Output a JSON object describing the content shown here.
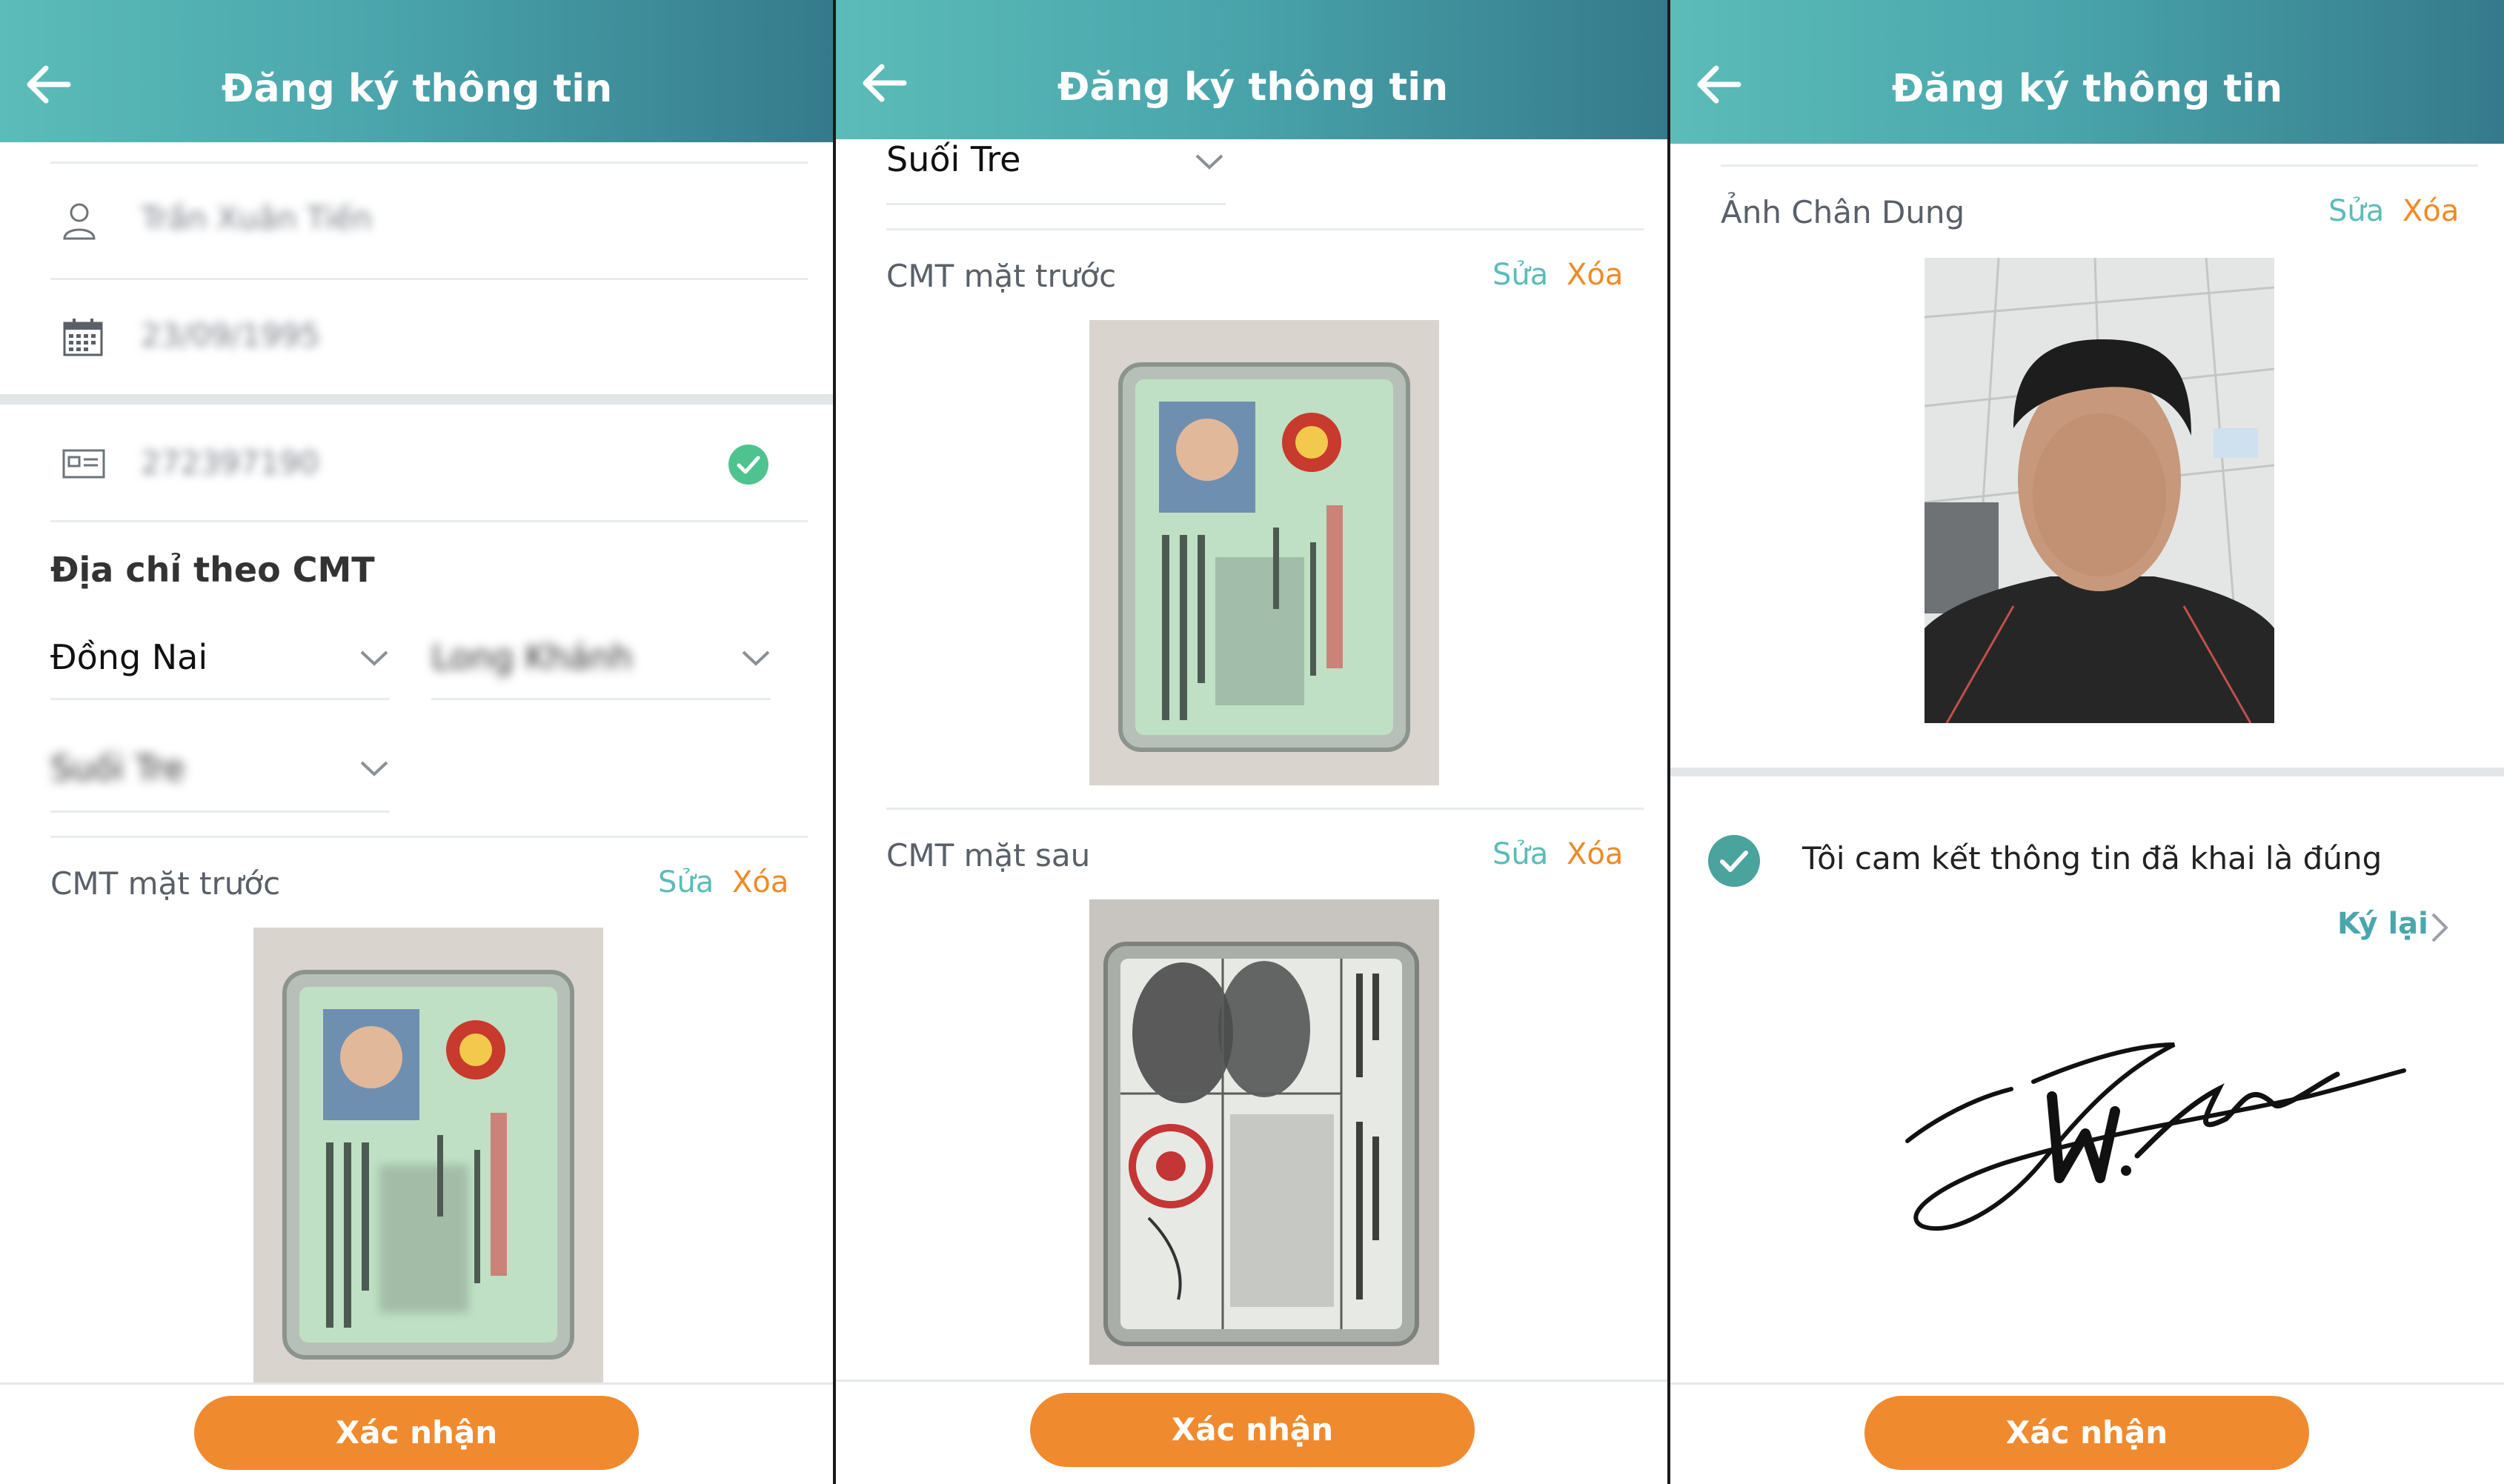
{
  "header": {
    "title": "Đăng ký thông tin"
  },
  "panel1": {
    "name_value": "Trần Xuân Tiến",
    "dob_value": "23/09/1995",
    "id_value": "272397190",
    "address_heading": "Địa chỉ theo CMT",
    "province": "Đồng Nai",
    "district": "Long Khánh",
    "ward": "Suối Tre",
    "front_label": "CMT mặt trước",
    "edit_label": "Sửa",
    "delete_label": "Xóa",
    "confirm_label": "Xác nhận"
  },
  "panel2": {
    "ward": "Suối Tre",
    "front_label": "CMT mặt trước",
    "back_label": "CMT mặt sau",
    "edit_label": "Sửa",
    "delete_label": "Xóa",
    "confirm_label": "Xác nhận"
  },
  "panel3": {
    "portrait_label": "Ảnh Chân Dung",
    "edit_label": "Sửa",
    "delete_label": "Xóa",
    "commit_text": "Tôi cam kết thông tin đã khai là đúng",
    "resign_label": "Ký lại",
    "confirm_label": "Xác nhận"
  },
  "colors": {
    "accent": "#5bbcb8",
    "orange": "#f08a2e",
    "check": "#4db89a"
  },
  "icons": [
    "back-arrow-icon",
    "user-icon",
    "calendar-icon",
    "id-card-icon",
    "check-circle-icon",
    "chevron-down-icon",
    "chevron-right-icon"
  ]
}
